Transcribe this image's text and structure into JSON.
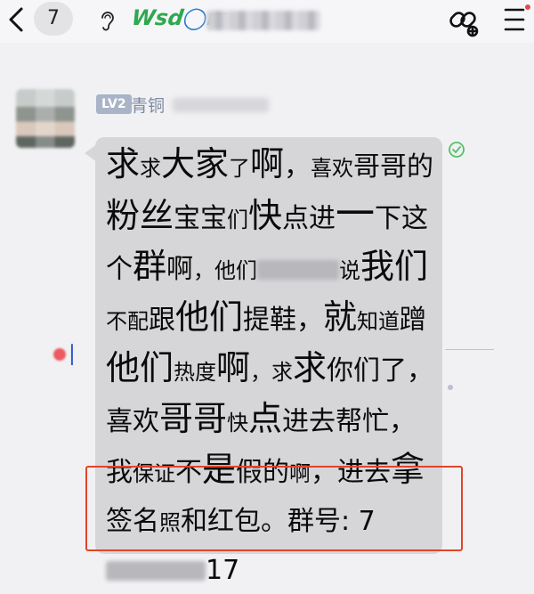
{
  "header": {
    "back_icon": "chevron-left-icon",
    "badge_count": "7",
    "ear_icon": "ear-icon",
    "watermark": {
      "text1": "Wsd",
      "text2": "m"
    },
    "link_icon": "link-icon",
    "menu_icon": "menu-icon"
  },
  "sender": {
    "level": "LV2",
    "rank": "青铜"
  },
  "message": {
    "segments": [
      {
        "t": "求",
        "c": "l"
      },
      {
        "t": "求",
        "c": "s"
      },
      {
        "t": "大家",
        "c": "l"
      },
      {
        "t": "了",
        "c": "s"
      },
      {
        "t": "啊",
        "c": "l"
      },
      {
        "t": "，",
        "c": "m"
      },
      {
        "t": "喜欢",
        "c": "s"
      },
      {
        "t": "哥哥",
        "c": "m"
      },
      {
        "t": "的",
        "c": "m"
      },
      {
        "t": "粉丝",
        "c": "l"
      },
      {
        "t": "宝宝",
        "c": "m"
      },
      {
        "t": "们",
        "c": "s"
      },
      {
        "t": "快",
        "c": "l"
      },
      {
        "t": "点进",
        "c": "m"
      },
      {
        "t": "一",
        "c": "xl"
      },
      {
        "t": "下这个",
        "c": "m"
      },
      {
        "t": "群",
        "c": "l"
      },
      {
        "t": "啊",
        "c": "m"
      },
      {
        "t": "，他们",
        "c": "s"
      },
      {
        "t": "__BLUR__"
      },
      {
        "t": "说",
        "c": "s"
      },
      {
        "t": "我们",
        "c": "l"
      },
      {
        "t": "不配",
        "c": "s"
      },
      {
        "t": "跟",
        "c": "m"
      },
      {
        "t": "他们",
        "c": "l"
      },
      {
        "t": "提鞋",
        "c": "m"
      },
      {
        "t": "，",
        "c": "m"
      },
      {
        "t": "就",
        "c": "l"
      },
      {
        "t": "知道",
        "c": "s"
      },
      {
        "t": "蹭",
        "c": "m"
      },
      {
        "t": "他们",
        "c": "l"
      },
      {
        "t": "热度",
        "c": "s"
      },
      {
        "t": "啊",
        "c": "l"
      },
      {
        "t": "，求",
        "c": "s"
      },
      {
        "t": "求",
        "c": "l"
      },
      {
        "t": "你们了",
        "c": "m"
      },
      {
        "t": "，喜欢",
        "c": "m"
      },
      {
        "t": "哥哥",
        "c": "l"
      },
      {
        "t": "快",
        "c": "s"
      },
      {
        "t": "点",
        "c": "l"
      },
      {
        "t": "进去帮忙",
        "c": "m"
      },
      {
        "t": "，我",
        "c": "m"
      },
      {
        "t": "保证",
        "c": "s"
      },
      {
        "t": "不",
        "c": "m"
      },
      {
        "t": "是",
        "c": "l"
      },
      {
        "t": "假的",
        "c": "m"
      },
      {
        "t": "啊",
        "c": "s"
      },
      {
        "t": "，进去",
        "c": "m"
      },
      {
        "t": "拿",
        "c": "l"
      },
      {
        "t": "签名",
        "c": "m"
      },
      {
        "t": "照",
        "c": "s"
      },
      {
        "t": "和红",
        "c": "m"
      },
      {
        "t": "包。群号: 7",
        "c": "m"
      },
      {
        "t": "__BLUR2__"
      },
      {
        "t": "17",
        "c": "m"
      }
    ],
    "read_icon": "check-circle-icon"
  },
  "colors": {
    "bubble": "#d6d6d9",
    "highlight_border": "#e0452a",
    "level_badge": "#a9b4c8"
  }
}
